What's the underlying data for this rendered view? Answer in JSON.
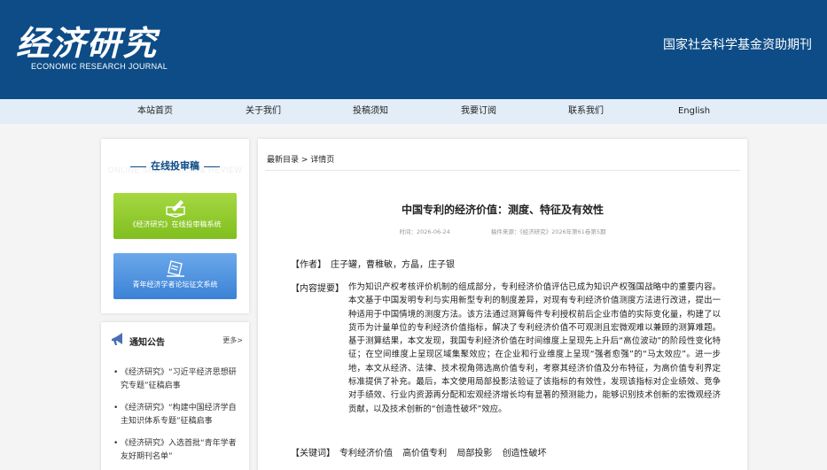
{
  "header": {
    "logo_cn": "经济研究",
    "logo_en": "ECONOMIC RESEARCH JOURNAL",
    "slogan": "国家社会科学基金资助期刊"
  },
  "nav": [
    "本站首页",
    "关于我们",
    "投稿须知",
    "我要订阅",
    "联系我们",
    "English"
  ],
  "submit_panel": {
    "title": "在线投审稿",
    "bg_text": "ONLINE SUBMISSION & REVIEW",
    "button_green": "《经济研究》在线投审稿系统",
    "button_blue": "青年经济学者论坛征文系统"
  },
  "notice": {
    "title": "通知公告",
    "more": "更多>",
    "items": [
      "《经济研究》“习近平经济思想研究专题”征稿启事",
      "《经济研究》“构建中国经济学自主知识体系专题”征稿启事",
      "《经济研究》入选首批“青年学者友好期刊名单”"
    ]
  },
  "article": {
    "breadcrumb": "最新目录 > 详情页",
    "title": "中国专利的经济价值：测度、特征及有效性",
    "time": "时间：2026-06-24",
    "source": "稿件来源：《经济研究》2026年第61卷第5期",
    "authors_label": "【作者】",
    "authors": "庄子罐，曹稚敏，方晶，庄子银",
    "abstract_label": "【内容提要】",
    "abstract": "作为知识产权考核评价机制的组成部分，专利经济价值评估已成为知识产权强国战略中的重要内容。本文基于中国发明专利与实用新型专利的制度差异，对现有专利经济价值测度方法进行改进，提出一种适用于中国情境的测度方法。该方法通过测算每件专利授权前后企业市值的实际变化量，构建了以货币为计量单位的专利经济价值指标，解决了专利经济价值不可观测且宏微观难以兼顾的测算难题。基于测算结果，本文发现，我国专利经济价值在时间维度上呈现先上升后“高位波动”的阶段性变化特征；在空间维度上呈现区域集聚效应；在企业和行业维度上呈现“强者愈强”的“马太效应”。进一步地，本文从经济、法律、技术视角筛选高价值专利，考察其经济价值及分布特征，为高价值专利界定标准提供了补充。最后，本文使用局部投影法验证了该指标的有效性，发现该指标对企业绩效、竞争对手绩效、行业内资源再分配和宏观经济增长均有显著的预测能力，能够识别技术创新的宏微观经济贡献，以及技术创新的“创造性破坏”效应。",
    "keywords_label": "【关键词】",
    "keywords": [
      "专利经济价值",
      "高价值专利",
      "局部投影",
      "创造性破坏"
    ]
  },
  "colors": {
    "header_bg": "#0d4c86",
    "nav_bg": "#e3edf7",
    "green_button": "#8cc63f",
    "blue_button": "#4a90e2"
  }
}
